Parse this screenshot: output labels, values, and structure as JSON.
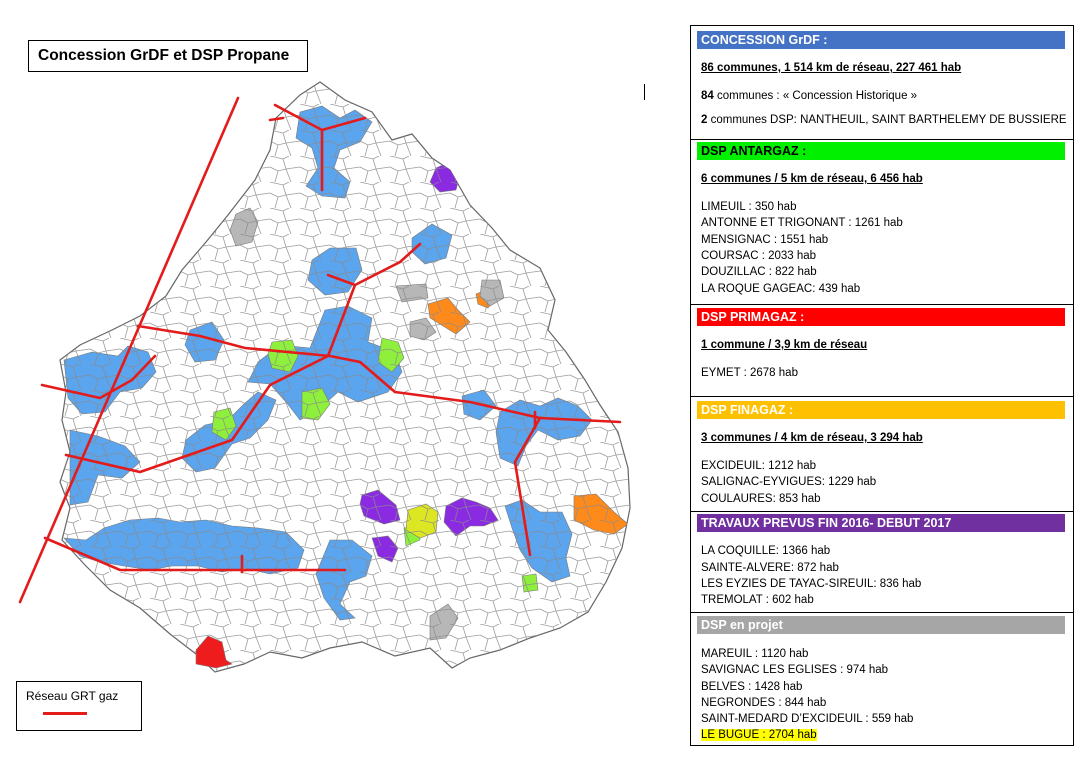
{
  "map": {
    "title": "Concession GrDF et DSP Propane",
    "legend": {
      "label": "Réseau GRT gaz",
      "line_color": "#e31b1b"
    },
    "colors": {
      "concession_grdf": "#5ba4ee",
      "dsp_antargaz": "#8ef03c",
      "dsp_primagaz": "#ee1c1c",
      "dsp_finagaz": "#ff8a1c",
      "travaux": "#8a2be2",
      "dsp_projet": "#b7b7b7",
      "le_bugue": "#dde622",
      "commune_border": "#7a7a7a",
      "grt_gaz": "#e31b1b"
    }
  },
  "panel": {
    "grdf": {
      "header": "CONCESSION GrDF :",
      "header_color": "#4472c4",
      "summary": "86 communes, 1 514 km de réseau,  227 461 hab",
      "line1_count": "84",
      "line1_text": " communes : « Concession Historique »",
      "line2_count": "2",
      "line2_text": " communes  DSP: NANTHEUIL, SAINT BARTHELEMY DE BUSSIERE"
    },
    "antargaz": {
      "header": "DSP ANTARGAZ :",
      "header_color": "#00f000",
      "summary": "6 communes / 5 km de réseau,  6 456 hab",
      "items": [
        "LIMEUIL : 350 hab",
        "ANTONNE ET TRIGONANT : 1261 hab",
        "MENSIGNAC : 1551 hab",
        "COURSAC : 2033 hab",
        "DOUZILLAC : 822 hab",
        "LA ROQUE GAGEAC: 439 hab"
      ]
    },
    "primagaz": {
      "header": "DSP PRIMAGAZ :",
      "header_color": "#ff0000",
      "summary": "1 commune / 3,9 km de réseau",
      "items": [
        "EYMET : 2678 hab"
      ]
    },
    "finagaz": {
      "header": "DSP FINAGAZ :",
      "header_color": "#ffc000",
      "summary": "3 communes / 4 km de réseau, 3 294 hab",
      "items": [
        "EXCIDEUIL: 1212 hab",
        "SALIGNAC-EYVIGUES: 1229 hab",
        "COULAURES: 853 hab"
      ]
    },
    "travaux": {
      "header": "TRAVAUX PREVUS FIN 2016- DEBUT 2017",
      "header_color": "#7030a0",
      "items": [
        "LA COQUILLE: 1366 hab",
        "SAINTE-ALVERE: 872 hab",
        "LES EYZIES DE TAYAC-SIREUIL: 836 hab",
        "TREMOLAT : 602 hab"
      ]
    },
    "projet": {
      "header": "DSP en projet",
      "header_color": "#a6a6a6",
      "items": [
        "MAREUIL : 1120 hab",
        "SAVIGNAC LES EGLISES : 974 hab",
        "BELVES : 1428 hab",
        "NEGRONDES : 844 hab",
        "SAINT-MEDARD D’EXCIDEUIL : 559 hab"
      ],
      "highlight_item": "LE BUGUE : 2704 hab",
      "highlight_color": "#ffff00"
    }
  }
}
